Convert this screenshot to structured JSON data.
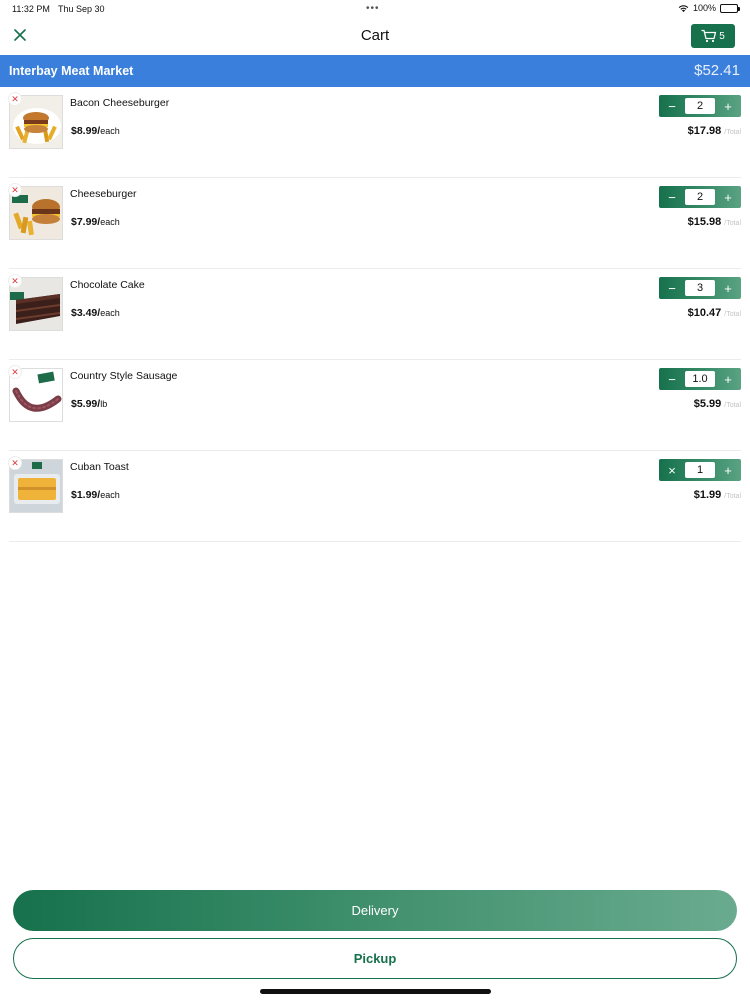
{
  "status_bar": {
    "time": "11:32 PM",
    "date": "Thu Sep 30",
    "dots": "•••",
    "battery": "100%"
  },
  "nav": {
    "title": "Cart",
    "cart_count": "5",
    "close_icon": "close-icon",
    "cart_icon": "cart-icon"
  },
  "store": {
    "name": "Interbay Meat Market",
    "total": "$52.41"
  },
  "items": [
    {
      "name": "Bacon Cheeseburger",
      "price": "$8.99/",
      "unit": "each",
      "quantity": "2",
      "line_total": "$17.98",
      "total_suffix": "/Total",
      "minus_symbol": "−",
      "image": "burger-fries-image"
    },
    {
      "name": "Cheeseburger",
      "price": "$7.99/",
      "unit": "each",
      "quantity": "2",
      "line_total": "$15.98",
      "total_suffix": "/Total",
      "minus_symbol": "−",
      "image": "burger-fries-image"
    },
    {
      "name": "Chocolate Cake",
      "price": "$3.49/",
      "unit": "each",
      "quantity": "3",
      "line_total": "$10.47",
      "total_suffix": "/Total",
      "minus_symbol": "−",
      "image": "cake-slice-image"
    },
    {
      "name": "Country Style Sausage",
      "price": "$5.99/",
      "unit": "lb",
      "quantity": "1.0",
      "line_total": "$5.99",
      "total_suffix": "/Total",
      "minus_symbol": "−",
      "image": "sausage-image"
    },
    {
      "name": "Cuban Toast",
      "price": "$1.99/",
      "unit": "each",
      "quantity": "1",
      "line_total": "$1.99",
      "total_suffix": "/Total",
      "minus_symbol": "×",
      "image": "toast-image"
    }
  ],
  "actions": {
    "delivery": "Delivery",
    "pickup": "Pickup"
  },
  "colors": {
    "brand_green": "#16714c",
    "store_blue": "#3b7fdc",
    "remove_red": "#d94040"
  }
}
